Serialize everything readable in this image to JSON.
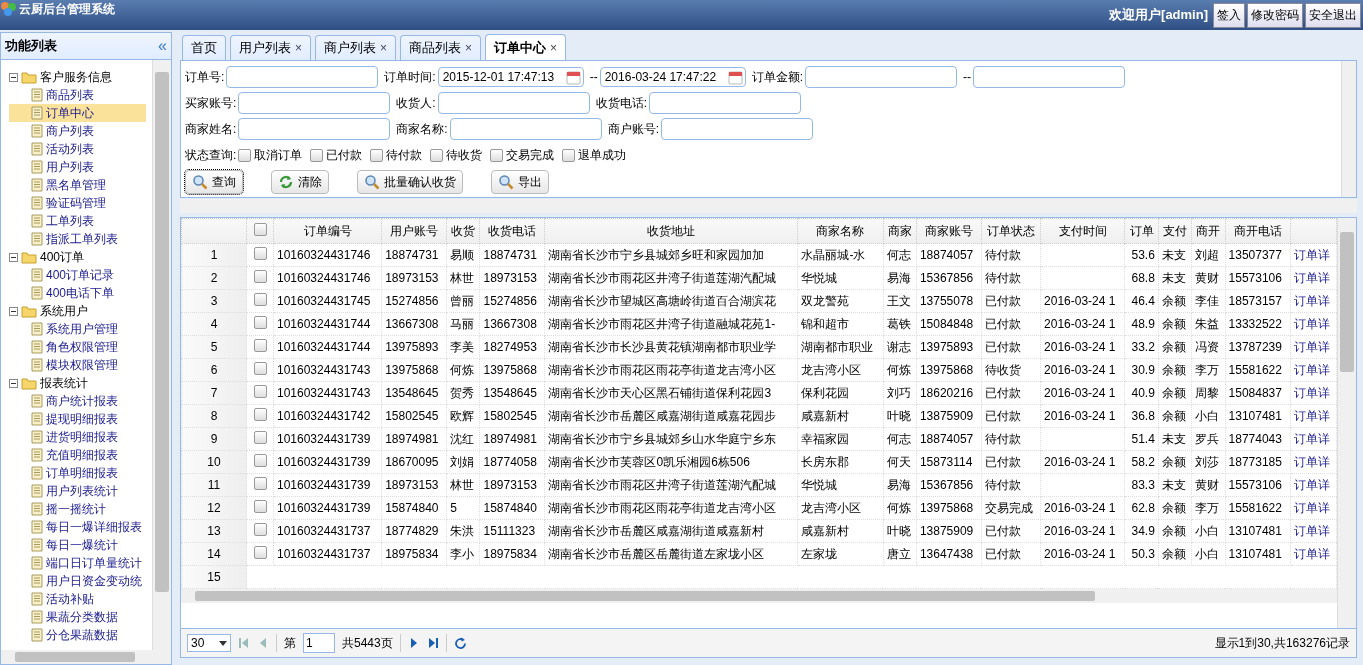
{
  "header": {
    "title": "云厨后台管理系统",
    "welcome": "欢迎用户[admin]",
    "buttons": [
      "签入",
      "修改密码",
      "安全退出"
    ]
  },
  "sidebar": {
    "title": "功能列表",
    "collapse": "«",
    "groups": [
      {
        "label": "客户服务信息",
        "expanded": true,
        "children": [
          {
            "label": "商品列表",
            "selected": false
          },
          {
            "label": "订单中心",
            "selected": true
          },
          {
            "label": "商户列表",
            "selected": false
          },
          {
            "label": "活动列表",
            "selected": false
          },
          {
            "label": "用户列表",
            "selected": false
          },
          {
            "label": "黑名单管理",
            "selected": false
          },
          {
            "label": "验证码管理",
            "selected": false
          },
          {
            "label": "工单列表",
            "selected": false
          },
          {
            "label": "指派工单列表",
            "selected": false
          }
        ]
      },
      {
        "label": "400订单",
        "expanded": true,
        "children": [
          {
            "label": "400订单记录",
            "selected": false
          },
          {
            "label": "400电话下单",
            "selected": false
          }
        ]
      },
      {
        "label": "系统用户",
        "expanded": true,
        "children": [
          {
            "label": "系统用户管理",
            "selected": false
          },
          {
            "label": "角色权限管理",
            "selected": false
          },
          {
            "label": "模块权限管理",
            "selected": false
          }
        ]
      },
      {
        "label": "报表统计",
        "expanded": true,
        "children": [
          {
            "label": "商户统计报表",
            "selected": false
          },
          {
            "label": "提现明细报表",
            "selected": false
          },
          {
            "label": "进货明细报表",
            "selected": false
          },
          {
            "label": "充值明细报表",
            "selected": false
          },
          {
            "label": "订单明细报表",
            "selected": false
          },
          {
            "label": "用户列表统计",
            "selected": false
          },
          {
            "label": "摇一摇统计",
            "selected": false
          },
          {
            "label": "每日一爆详细报表",
            "selected": false
          },
          {
            "label": "每日一爆统计",
            "selected": false
          },
          {
            "label": "端口日订单量统计",
            "selected": false
          },
          {
            "label": "用户日资金变动统",
            "selected": false
          },
          {
            "label": "活动补贴",
            "selected": false
          },
          {
            "label": "果蔬分类数据",
            "selected": false
          },
          {
            "label": "分仓果蔬数据",
            "selected": false
          }
        ]
      }
    ]
  },
  "tabs": [
    {
      "label": "首页",
      "selected": false
    },
    {
      "label": "用户列表",
      "close": "×",
      "selected": false
    },
    {
      "label": "商户列表",
      "close": "×",
      "selected": false
    },
    {
      "label": "商品列表",
      "close": "×",
      "selected": false
    },
    {
      "label": "订单中心",
      "close": "×",
      "selected": true
    }
  ],
  "filters": [
    [
      {
        "kind": "label",
        "text": "订单号:"
      },
      {
        "kind": "text"
      },
      {
        "kind": "label",
        "text": "订单时间:"
      },
      {
        "kind": "date",
        "value": "2015-12-01 17:47:13"
      },
      {
        "kind": "label",
        "text": "--"
      },
      {
        "kind": "date",
        "value": "2016-03-24 17:47:22"
      },
      {
        "kind": "label",
        "text": "订单金额:"
      },
      {
        "kind": "text"
      },
      {
        "kind": "label",
        "text": "--"
      },
      {
        "kind": "text"
      }
    ],
    [
      {
        "kind": "label",
        "text": "买家账号:"
      },
      {
        "kind": "text"
      },
      {
        "kind": "label",
        "text": "收货人:"
      },
      {
        "kind": "text"
      },
      {
        "kind": "label",
        "text": "收货电话:"
      },
      {
        "kind": "text"
      }
    ],
    [
      {
        "kind": "label",
        "text": "商家姓名:"
      },
      {
        "kind": "text"
      },
      {
        "kind": "label",
        "text": "商家名称:"
      },
      {
        "kind": "text"
      },
      {
        "kind": "label",
        "text": "商户账号:"
      },
      {
        "kind": "text"
      }
    ]
  ],
  "status_filter": {
    "label": "状态查询:",
    "options": [
      {
        "label": "取消订单",
        "checked": false
      },
      {
        "label": "已付款",
        "checked": false
      },
      {
        "label": "待付款",
        "checked": false
      },
      {
        "label": "待收货",
        "checked": false
      },
      {
        "label": "交易完成",
        "checked": false
      },
      {
        "label": "退单成功",
        "checked": false
      }
    ]
  },
  "actions": [
    {
      "label": "查询",
      "kind": "search",
      "focused": true
    },
    {
      "label": "清除",
      "kind": "refresh",
      "focused": false
    },
    {
      "label": "批量确认收货",
      "kind": "search",
      "focused": false
    },
    {
      "label": "导出",
      "kind": "search",
      "focused": false
    }
  ],
  "table": {
    "all_checked": false,
    "columns": [
      "订单编号",
      "用户账号",
      "收货",
      "收货电话",
      "收货地址",
      "商家名称",
      "商家",
      "商家账号",
      "订单状态",
      "支付时间",
      "订单",
      "支付",
      "商开",
      "商开电话"
    ],
    "rows": [
      {
        "number": "1",
        "checked": false,
        "cells": [
          "10160324431746",
          "18874731",
          "易顺",
          "18874731",
          "湖南省长沙市宁乡县城郊乡旺和家园加加",
          "水晶丽城-水",
          "何志",
          "18874057",
          "待付款",
          "",
          "53.6",
          "未支",
          "刘超",
          "13507377"
        ],
        "link": "订单详"
      },
      {
        "number": "2",
        "checked": false,
        "cells": [
          "10160324431746",
          "18973153",
          "林世",
          "18973153",
          "湖南省长沙市雨花区井湾子街道莲湖汽配城",
          "华悦城",
          "易海",
          "15367856",
          "待付款",
          "",
          "68.8",
          "未支",
          "黄财",
          "15573106"
        ],
        "link": "订单详"
      },
      {
        "number": "3",
        "checked": false,
        "cells": [
          "10160324431745",
          "15274856",
          "曾丽",
          "15274856",
          "湖南省长沙市望城区高塘岭街道百合湖滨花",
          "双龙警苑",
          "王文",
          "13755078",
          "已付款",
          "2016-03-24 1",
          "46.4",
          "余额",
          "李佳",
          "18573157"
        ],
        "link": "订单详"
      },
      {
        "number": "4",
        "checked": false,
        "cells": [
          "10160324431744",
          "13667308",
          "马丽",
          "13667308",
          "湖南省长沙市雨花区井湾子街道融城花苑1-",
          "锦和超市",
          "葛铁",
          "15084848",
          "已付款",
          "2016-03-24 1",
          "48.9",
          "余额",
          "朱益",
          "13332522"
        ],
        "link": "订单详"
      },
      {
        "number": "5",
        "checked": false,
        "cells": [
          "10160324431744",
          "13975893",
          "李美",
          "18274953",
          "湖南省长沙市长沙县黄花镇湖南都市职业学",
          "湖南都市职业",
          "谢志",
          "13975893",
          "已付款",
          "2016-03-24 1",
          "33.2",
          "余额",
          "冯资",
          "13787239"
        ],
        "link": "订单详"
      },
      {
        "number": "6",
        "checked": false,
        "cells": [
          "10160324431743",
          "13975868",
          "何炼",
          "13975868",
          "湖南省长沙市雨花区雨花亭街道龙吉湾小区",
          "龙吉湾小区",
          "何炼",
          "13975868",
          "待收货",
          "2016-03-24 1",
          "30.9",
          "余额",
          "李万",
          "15581622"
        ],
        "link": "订单详"
      },
      {
        "number": "7",
        "checked": false,
        "cells": [
          "10160324431743",
          "13548645",
          "贺秀",
          "13548645",
          "湖南省长沙市天心区黑石铺街道保利花园3",
          "保利花园",
          "刘巧",
          "18620216",
          "已付款",
          "2016-03-24 1",
          "40.9",
          "余额",
          "周黎",
          "15084837"
        ],
        "link": "订单详"
      },
      {
        "number": "8",
        "checked": false,
        "cells": [
          "10160324431742",
          "15802545",
          "欧辉",
          "15802545",
          "湖南省长沙市岳麓区咸嘉湖街道咸嘉花园步",
          "咸嘉新村",
          "叶晓",
          "13875909",
          "已付款",
          "2016-03-24 1",
          "36.8",
          "余额",
          "小白",
          "13107481"
        ],
        "link": "订单详"
      },
      {
        "number": "9",
        "checked": false,
        "cells": [
          "10160324431739",
          "18974981",
          "沈红",
          "18974981",
          "湖南省长沙市宁乡县城郊乡山水华庭宁乡东",
          "幸福家园",
          "何志",
          "18874057",
          "待付款",
          "",
          "51.4",
          "未支",
          "罗兵",
          "18774043"
        ],
        "link": "订单详"
      },
      {
        "number": "10",
        "checked": false,
        "cells": [
          "10160324431739",
          "18670095",
          "刘娟",
          "18774058",
          "湖南省长沙市芙蓉区0凯乐湘园6栋506",
          "长房东郡",
          "何天",
          "15873114",
          "已付款",
          "2016-03-24 1",
          "58.2",
          "余额",
          "刘莎",
          "18773185"
        ],
        "link": "订单详"
      },
      {
        "number": "11",
        "checked": false,
        "cells": [
          "10160324431739",
          "18973153",
          "林世",
          "18973153",
          "湖南省长沙市雨花区井湾子街道莲湖汽配城",
          "华悦城",
          "易海",
          "15367856",
          "待付款",
          "",
          "83.3",
          "未支",
          "黄财",
          "15573106"
        ],
        "link": "订单详"
      },
      {
        "number": "12",
        "checked": false,
        "cells": [
          "10160324431739",
          "15874840",
          "5",
          "15874840",
          "湖南省长沙市雨花区雨花亭街道龙吉湾小区",
          "龙吉湾小区",
          "何炼",
          "13975868",
          "交易完成",
          "2016-03-24 1",
          "62.8",
          "余额",
          "李万",
          "15581622"
        ],
        "link": "订单详"
      },
      {
        "number": "13",
        "checked": false,
        "cells": [
          "10160324431737",
          "18774829",
          "朱洪",
          "15111323",
          "湖南省长沙市岳麓区咸嘉湖街道咸嘉新村",
          "咸嘉新村",
          "叶晓",
          "13875909",
          "已付款",
          "2016-03-24 1",
          "34.9",
          "余额",
          "小白",
          "13107481"
        ],
        "link": "订单详"
      },
      {
        "number": "14",
        "checked": false,
        "cells": [
          "10160324431737",
          "18975834",
          "李小",
          "18975834",
          "湖南省长沙市岳麓区岳麓街道左家垅小区",
          "左家垅",
          "唐立",
          "13647438",
          "已付款",
          "2016-03-24 1",
          "50.3",
          "余额",
          "小白",
          "13107481"
        ],
        "link": "订单详"
      }
    ],
    "cut_row_number": "15"
  },
  "pager": {
    "page_size": "30",
    "page_label": "第",
    "page": "1",
    "total_pages": "共5443页",
    "summary": "显示1到30,共163276记录"
  }
}
